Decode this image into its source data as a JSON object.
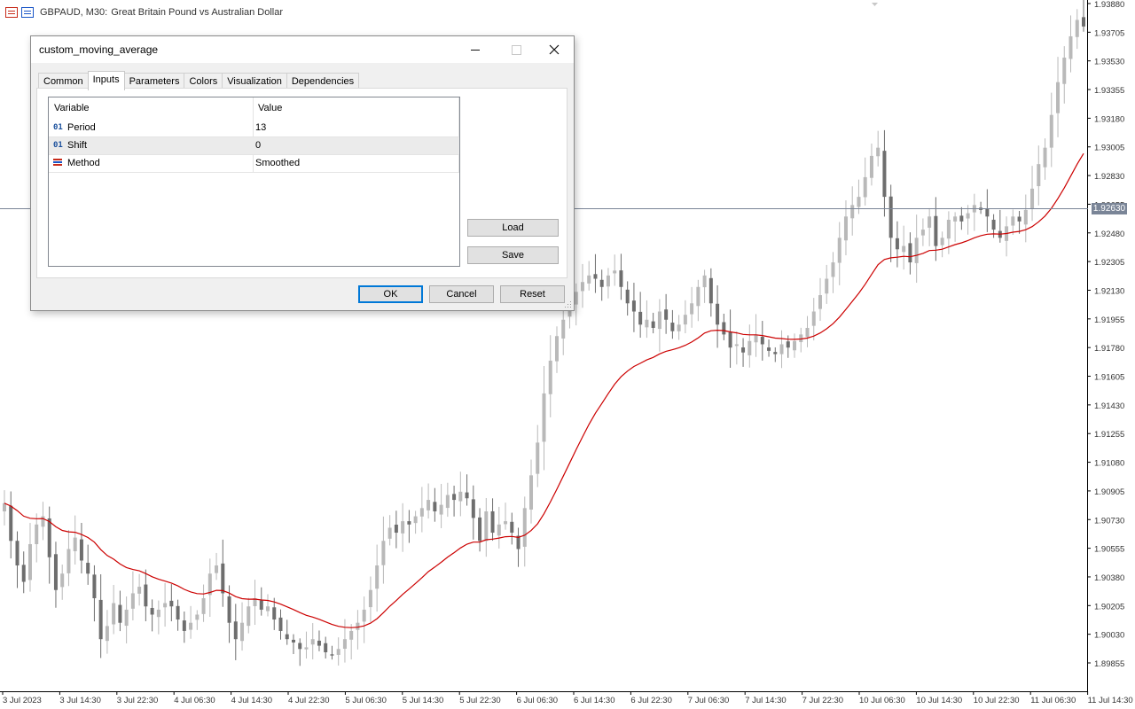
{
  "window": {
    "symbol": "GBPAUD, M30:",
    "description": "Great Britain Pound vs Australian Dollar",
    "current_price": "1.92630"
  },
  "colors": {
    "bull_candle": "#b9b9b9",
    "bear_candle": "#6e6e6e",
    "moving_average": "#cc0000",
    "price_line": "#7a8597"
  },
  "chart_data": {
    "type": "candlestick",
    "y_axis_labels": [
      "1.93880",
      "1.93705",
      "1.93530",
      "1.93355",
      "1.93180",
      "1.93005",
      "1.92830",
      "1.92655",
      "1.92480",
      "1.92305",
      "1.92130",
      "1.91955",
      "1.91780",
      "1.91605",
      "1.91430",
      "1.91255",
      "1.91080",
      "1.90905",
      "1.90730",
      "1.90555",
      "1.90380",
      "1.90205",
      "1.90030",
      "1.89855"
    ],
    "x_axis_labels": [
      "3 Jul 2023",
      "3 Jul 14:30",
      "3 Jul 22:30",
      "4 Jul 06:30",
      "4 Jul 14:30",
      "4 Jul 22:30",
      "5 Jul 06:30",
      "5 Jul 14:30",
      "5 Jul 22:30",
      "6 Jul 06:30",
      "6 Jul 14:30",
      "6 Jul 22:30",
      "7 Jul 06:30",
      "7 Jul 14:30",
      "7 Jul 22:30",
      "10 Jul 06:30",
      "10 Jul 14:30",
      "10 Jul 22:30",
      "11 Jul 06:30",
      "11 Jul 14:30"
    ],
    "ylim": [
      1.8977,
      1.9388
    ],
    "close": [
      1.9083,
      1.906,
      1.9045,
      1.9035,
      1.9058,
      1.907,
      1.9075,
      1.905,
      1.903,
      1.904,
      1.9055,
      1.9062,
      1.9048,
      1.904,
      1.9025,
      1.9,
      1.9008,
      1.9022,
      1.901,
      1.9018,
      1.9028,
      1.9032,
      1.902,
      1.9015,
      1.9018,
      1.9022,
      1.902,
      1.9012,
      1.9005,
      1.901,
      1.9015,
      1.9025,
      1.904,
      1.9045,
      1.9028,
      1.901,
      1.9,
      1.901,
      1.902,
      1.9025,
      1.9018,
      1.902,
      1.9012,
      1.9005,
      1.9,
      1.8998,
      1.8994,
      1.8995,
      1.9,
      1.8996,
      1.8992,
      1.899,
      1.8994,
      1.9,
      1.9005,
      1.901,
      1.9018,
      1.903,
      1.9045,
      1.906,
      1.9068,
      1.9065,
      1.9072,
      1.907,
      1.9075,
      1.908,
      1.9085,
      1.9078,
      1.9082,
      1.9088,
      1.9085,
      1.909,
      1.9086,
      1.9074,
      1.906,
      1.9078,
      1.9065,
      1.907,
      1.9072,
      1.9065,
      1.9055,
      1.908,
      1.91,
      1.912,
      1.915,
      1.917,
      1.9185,
      1.9195,
      1.9205,
      1.9212,
      1.9218,
      1.9222,
      1.922,
      1.9215,
      1.9222,
      1.9225,
      1.9215,
      1.9205,
      1.92,
      1.9192,
      1.9195,
      1.919,
      1.92,
      1.9195,
      1.9188,
      1.9192,
      1.9198,
      1.9205,
      1.9215,
      1.9222,
      1.9205,
      1.9192,
      1.9186,
      1.9178,
      1.918,
      1.9175,
      1.9182,
      1.9186,
      1.918,
      1.9176,
      1.9174,
      1.918,
      1.9178,
      1.9182,
      1.9186,
      1.919,
      1.92,
      1.921,
      1.922,
      1.923,
      1.9245,
      1.9258,
      1.9265,
      1.927,
      1.9282,
      1.9295,
      1.93,
      1.927,
      1.9245,
      1.9238,
      1.924,
      1.923,
      1.9245,
      1.925,
      1.9258,
      1.924,
      1.9245,
      1.9256,
      1.9258,
      1.9255,
      1.926,
      1.9265,
      1.9262,
      1.9258,
      1.925,
      1.9245,
      1.9252,
      1.9258,
      1.9255,
      1.9262,
      1.9275,
      1.929,
      1.93,
      1.932,
      1.934,
      1.9355,
      1.9368,
      1.9378,
      1.9374
    ],
    "moving_average": {
      "name": "Smoothed",
      "period": 13,
      "shift": 0
    }
  },
  "dialog": {
    "title": "custom_moving_average",
    "tabs": [
      "Common",
      "Inputs",
      "Parameters",
      "Colors",
      "Visualization",
      "Dependencies"
    ],
    "active_tab": "Inputs",
    "grid": {
      "col_variable": "Variable",
      "col_value": "Value",
      "rows": [
        {
          "type_icon": "01",
          "variable": "Period",
          "value": "13"
        },
        {
          "type_icon": "01",
          "variable": "Shift",
          "value": "0"
        },
        {
          "type_icon": "enum-icon",
          "variable": "Method",
          "value": "Smoothed"
        }
      ]
    },
    "buttons": {
      "load": "Load",
      "save": "Save",
      "ok": "OK",
      "cancel": "Cancel",
      "reset": "Reset"
    }
  }
}
